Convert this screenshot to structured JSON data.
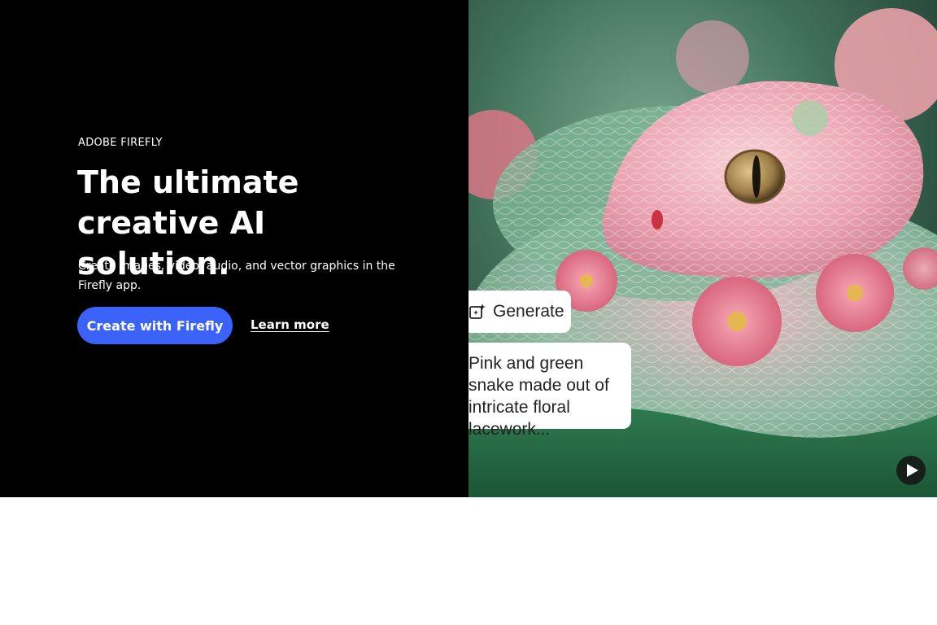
{
  "hero": {
    "eyebrow": "ADOBE FIREFLY",
    "headline": "The ultimate creative AI solution.",
    "subtext": "Create images, video, audio, and vector graphics in the Firefly app.",
    "cta_label": "Create with Firefly",
    "learn_more_label": "Learn more"
  },
  "media": {
    "image_subject": "pink and green embroidered snake with floral lacework",
    "generate_chip": {
      "icon": "magic-wand-sparkle-icon",
      "label": "Generate"
    },
    "prompt_text": "Pink and green snake made out of intricate floral lacework...",
    "play_icon": "play-icon"
  },
  "colors": {
    "left_panel_bg": "#000000",
    "cta_bg": "#3b63fb",
    "text_light": "#ffffff"
  }
}
